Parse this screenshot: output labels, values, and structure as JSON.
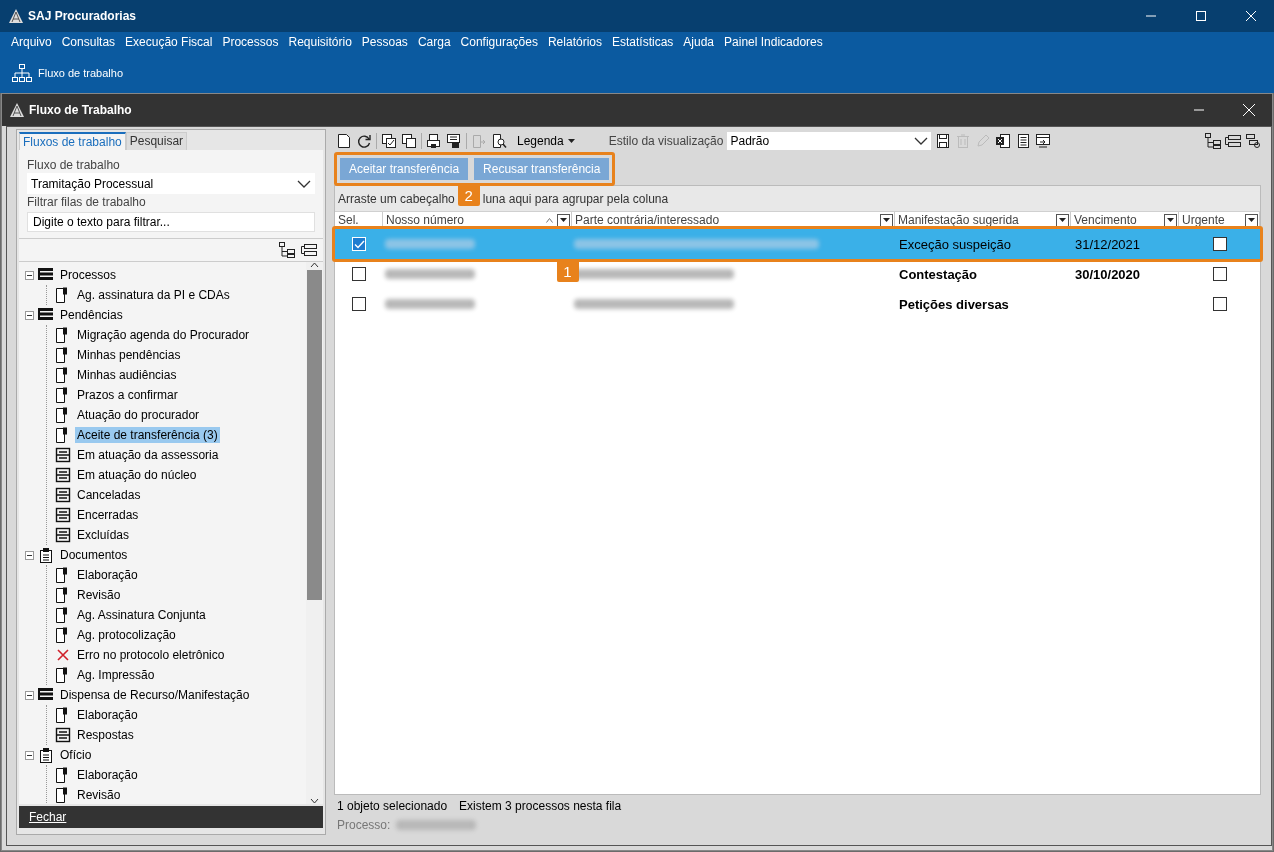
{
  "app": {
    "title": "SAJ Procuradorias"
  },
  "menu": [
    "Arquivo",
    "Consultas",
    "Execução Fiscal",
    "Processos",
    "Requisitório",
    "Pessoas",
    "Carga",
    "Configurações",
    "Relatórios",
    "Estatísticas",
    "Ajuda",
    "Painel Indicadores"
  ],
  "ribbon": [
    {
      "label": "Fluxo de trabalho"
    }
  ],
  "window": {
    "title": "Fluxo de Trabalho"
  },
  "left_tabs": [
    {
      "label": "Fluxos de trabalho",
      "selected": true
    },
    {
      "label": "Pesquisar",
      "selected": false
    }
  ],
  "filters": {
    "workflow_label": "Fluxo de trabalho",
    "workflow_value": "Tramitação Processual",
    "filter_label": "Filtrar filas de trabalho",
    "filter_placeholder": "Digite o texto para filtrar..."
  },
  "tree": [
    {
      "label": "Processos",
      "kind": "list",
      "expanded": true,
      "selected": false,
      "children": [
        {
          "label": "Ag. assinatura da PI e CDAs",
          "kind": "doc",
          "selected": false
        }
      ]
    },
    {
      "label": "Pendências",
      "kind": "list",
      "expanded": true,
      "selected": false,
      "children": [
        {
          "label": "Migração agenda do Procurador",
          "kind": "doc",
          "selected": false
        },
        {
          "label": "Minhas pendências",
          "kind": "doc",
          "selected": false
        },
        {
          "label": "Minhas audiências",
          "kind": "doc",
          "selected": false
        },
        {
          "label": "Prazos a confirmar",
          "kind": "doc",
          "selected": false
        },
        {
          "label": "Atuação do procurador",
          "kind": "doc",
          "selected": false
        },
        {
          "label": "Aceite de transferência (3)",
          "kind": "doc",
          "selected": true
        },
        {
          "label": "Em atuação da assessoria",
          "kind": "grid",
          "selected": false
        },
        {
          "label": "Em atuação do núcleo",
          "kind": "grid",
          "selected": false
        },
        {
          "label": "Canceladas",
          "kind": "grid",
          "selected": false
        },
        {
          "label": "Encerradas",
          "kind": "grid",
          "selected": false
        },
        {
          "label": "Excluídas",
          "kind": "grid",
          "selected": false
        }
      ]
    },
    {
      "label": "Documentos",
      "kind": "docs",
      "expanded": true,
      "selected": false,
      "children": [
        {
          "label": "Elaboração",
          "kind": "doc",
          "selected": false
        },
        {
          "label": "Revisão",
          "kind": "doc",
          "selected": false
        },
        {
          "label": "Ag. Assinatura Conjunta",
          "kind": "doc",
          "selected": false
        },
        {
          "label": "Ag. protocolização",
          "kind": "doc",
          "selected": false
        },
        {
          "label": "Erro no protocolo eletrônico",
          "kind": "error",
          "selected": false
        },
        {
          "label": "Ag. Impressão",
          "kind": "doc",
          "selected": false
        }
      ]
    },
    {
      "label": "Dispensa de Recurso/Manifestação",
      "kind": "list",
      "expanded": true,
      "selected": false,
      "children": [
        {
          "label": "Elaboração",
          "kind": "doc",
          "selected": false
        },
        {
          "label": "Respostas",
          "kind": "grid",
          "selected": false
        }
      ]
    },
    {
      "label": "Ofício",
      "kind": "docs",
      "expanded": true,
      "selected": false,
      "children": [
        {
          "label": "Elaboração",
          "kind": "doc",
          "selected": false
        },
        {
          "label": "Revisão",
          "kind": "doc",
          "selected": false
        }
      ]
    }
  ],
  "close_button": "Fechar",
  "toolbar": {
    "legend": "Legenda",
    "style_label": "Estilo da visualização",
    "style_value": "Padrão"
  },
  "actions": {
    "buttons": [
      "Aceitar transferência",
      "Recusar transferência"
    ],
    "callout": "2"
  },
  "group_hint": [
    "Arraste um cabeçalho",
    "luna aqui para agrupar pela coluna"
  ],
  "table": {
    "columns": [
      "Sel.",
      "Nosso número",
      "Parte contrária/interessado",
      "Manifestação sugerida",
      "Vencimento",
      "Urgente"
    ],
    "rows": [
      {
        "checked": true,
        "selected": true,
        "bold": false,
        "callout": "1",
        "manifestacao": "Exceção suspeição",
        "vencimento": "31/12/2021",
        "urgent": false
      },
      {
        "checked": false,
        "selected": false,
        "bold": true,
        "manifestacao": "Contestação",
        "vencimento": "30/10/2020",
        "urgent": false
      },
      {
        "checked": false,
        "selected": false,
        "bold": true,
        "manifestacao": "Petições diversas",
        "urgent": false
      }
    ]
  },
  "status": [
    "1 objeto selecionado",
    "Existem 3 processos nesta fila"
  ],
  "process_label": "Processo:"
}
